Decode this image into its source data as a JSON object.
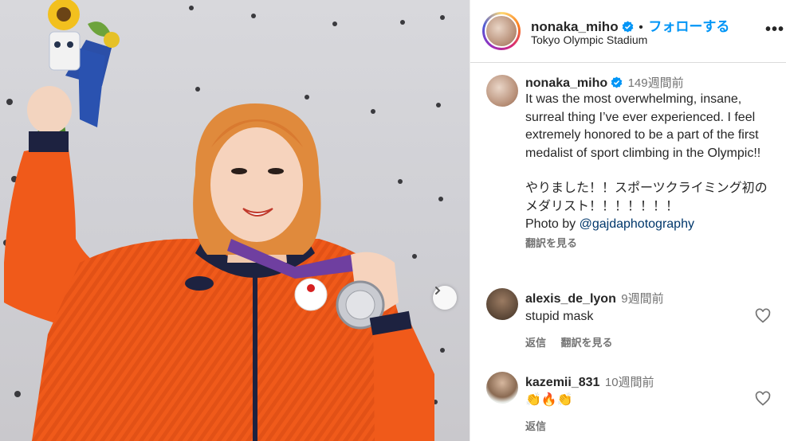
{
  "post": {
    "username": "nonaka_miho",
    "separator": "•",
    "follow_label": "フォローする",
    "location": "Tokyo Olympic Stadium",
    "more_icon": "•••",
    "next_icon": "chevron-right-icon"
  },
  "caption": {
    "username": "nonaka_miho",
    "time": "149週間前",
    "paragraph_en": "It was the most overwhelming, insane, surreal thing I’ve ever experienced. I feel extremely honored to be a part of the first medalist of sport climbing in the Olympic!!",
    "paragraph_jp": "やりました！！スポーツクライミング初のメダリスト！！！！！！！",
    "photo_by": "Photo by",
    "photo_handle": "@gajdaphotography",
    "translate_label": "翻訳を見る"
  },
  "comments": [
    {
      "username": "alexis_de_lyon",
      "time": "9週間前",
      "text": "stupid mask",
      "reply_label": "返信",
      "translate_label": "翻訳を見る"
    },
    {
      "username": "kazemii_831",
      "time": "10週間前",
      "text": "👏🔥👏",
      "reply_label": "返信"
    }
  ],
  "colors": {
    "accent": "#0095f6",
    "jacket": "#f05a1a",
    "hair": "#e08a3c",
    "wall": "#d6d6da"
  }
}
